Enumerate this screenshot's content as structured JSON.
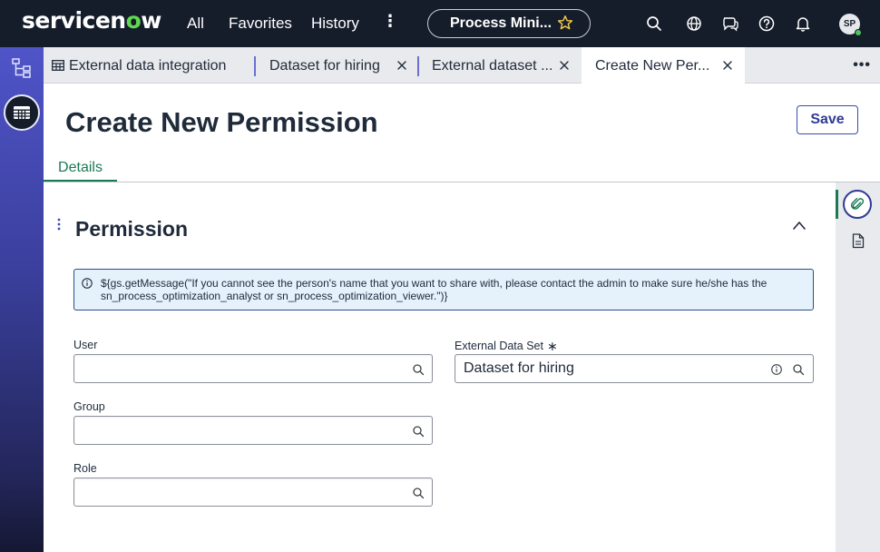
{
  "topnav": {
    "logo": "servicenow",
    "links": [
      "All",
      "Favorites",
      "History"
    ],
    "context_pill": "Process Mini...",
    "avatar_initials": "SP",
    "icons": [
      "more-vertical-icon",
      "star-icon",
      "search-icon",
      "globe-icon",
      "chat-icon",
      "help-icon",
      "bell-icon"
    ]
  },
  "left_rail": {
    "icons": [
      "hierarchy-tree-icon",
      "table-grid-icon"
    ]
  },
  "tabs": [
    {
      "label": "External data integration",
      "icon": "table-icon",
      "closable": false,
      "active": false
    },
    {
      "label": "Dataset for hiring",
      "closable": true,
      "active": false
    },
    {
      "label": "External dataset ...",
      "closable": true,
      "active": false
    },
    {
      "label": "Create New Per...",
      "closable": true,
      "active": true
    }
  ],
  "page": {
    "title": "Create New Permission",
    "save_label": "Save",
    "form_tab": "Details"
  },
  "section": {
    "title": "Permission",
    "info_message": "${gs.getMessage(\"If you cannot see the person's name that you want to share with, please contact the admin to make sure he/she has the sn_process_optimization_analyst or sn_process_optimization_viewer.\")}"
  },
  "fields": {
    "user": {
      "label": "User",
      "value": ""
    },
    "group": {
      "label": "Group",
      "value": ""
    },
    "role": {
      "label": "Role",
      "value": ""
    },
    "external_data_set": {
      "label": "External Data Set",
      "required_mark": "∗",
      "value": "Dataset for hiring"
    }
  },
  "right_panel": {
    "icons": [
      "paperclip-icon",
      "document-icon"
    ]
  },
  "colors": {
    "topnav_bg": "#151d2b",
    "accent_green": "#1b7a55",
    "primary_blue": "#2f3b95",
    "info_bg": "#e5f1fb"
  }
}
